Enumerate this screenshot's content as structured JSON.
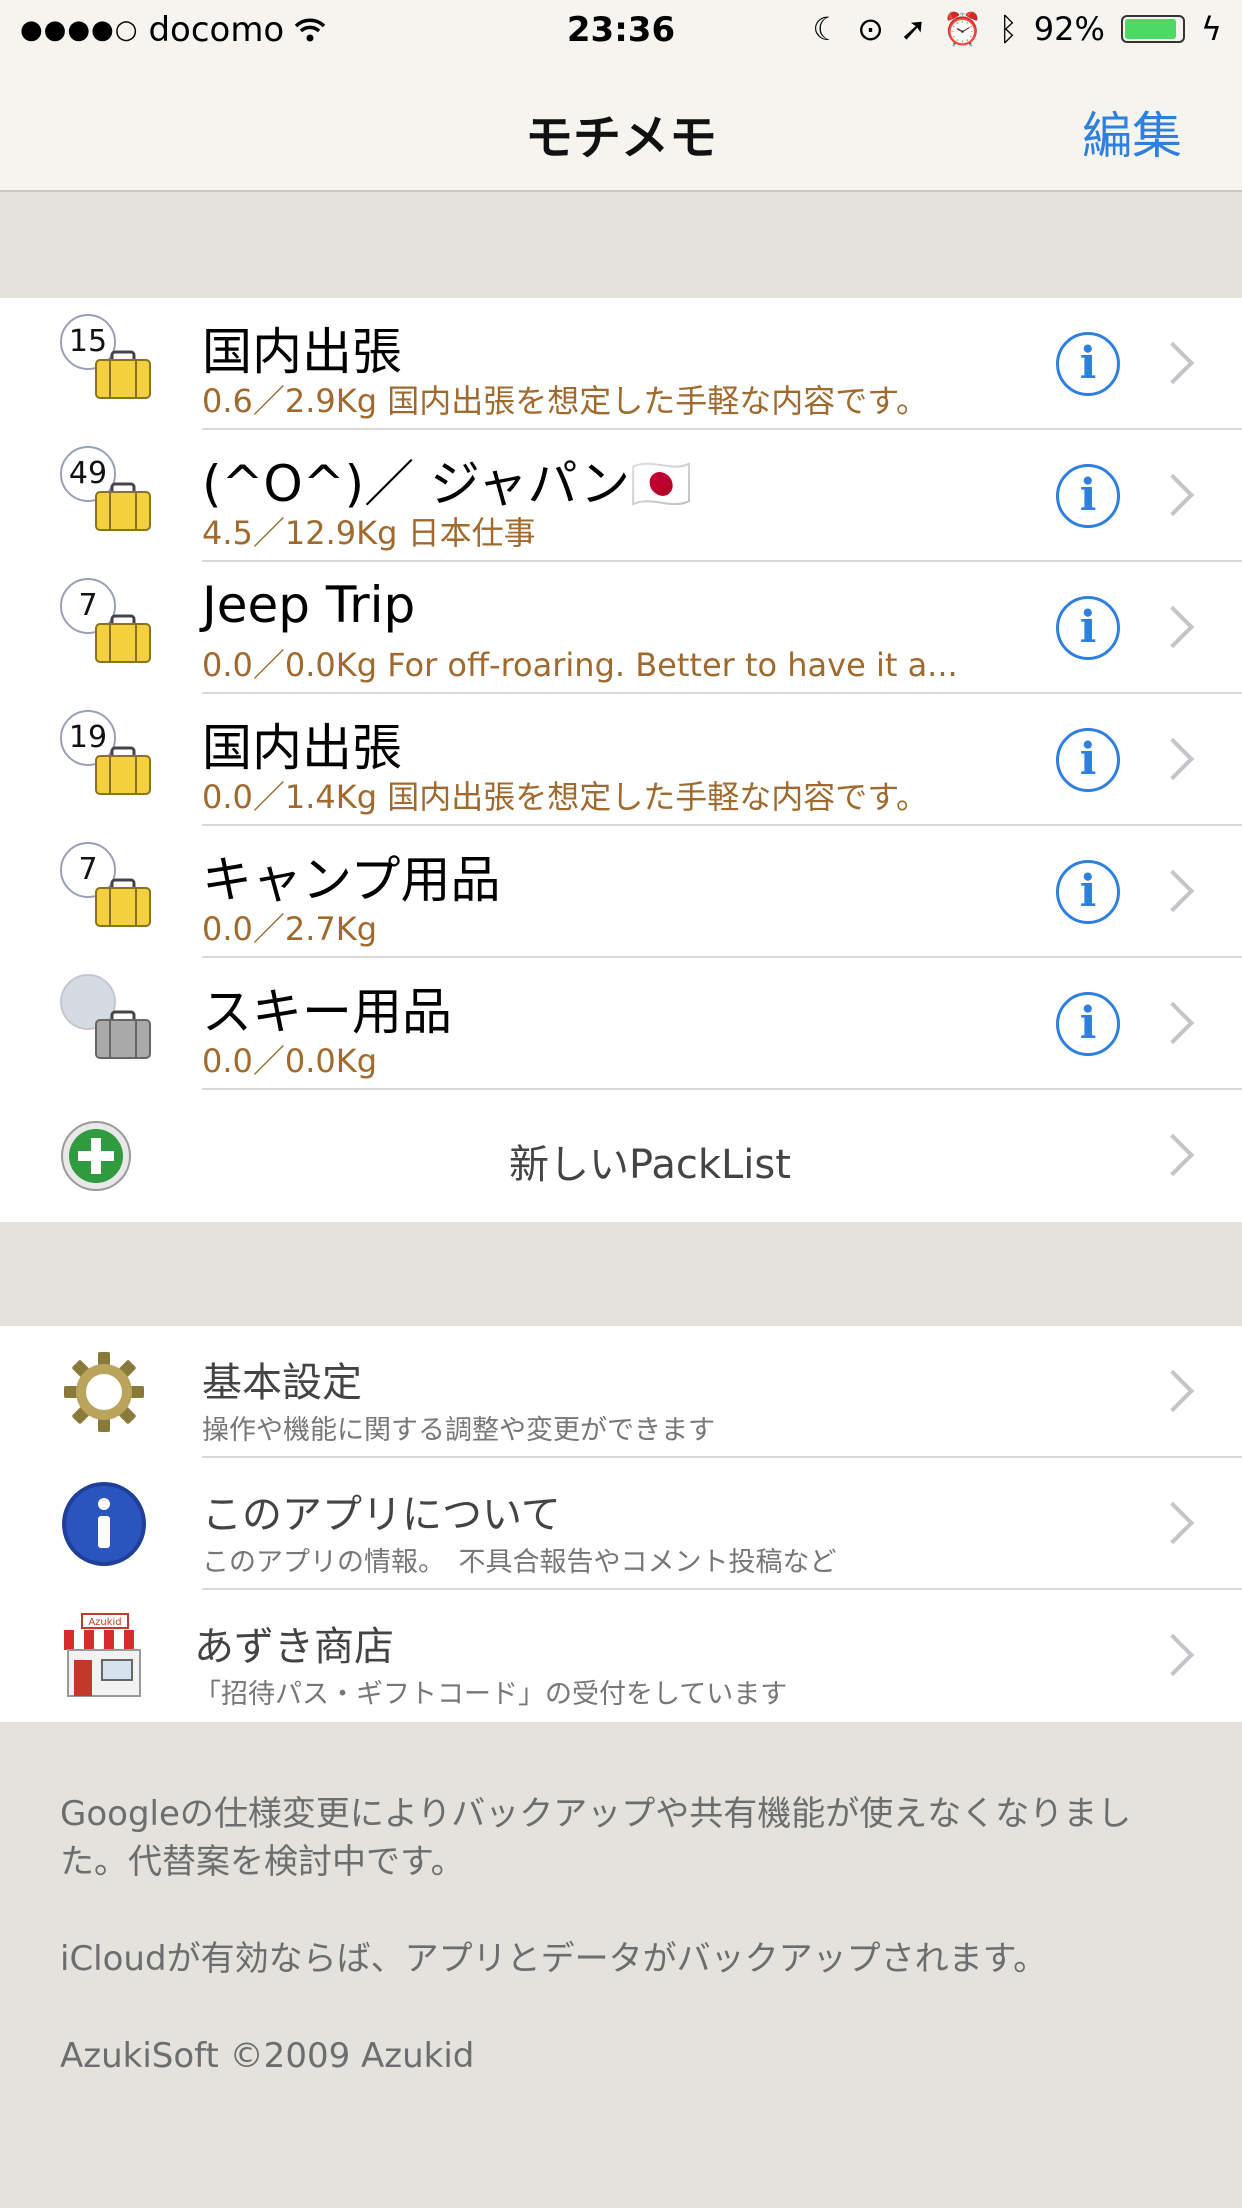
{
  "status_bar": {
    "signal": "●●●●○",
    "carrier": "docomo",
    "time": "23:36",
    "battery": "92%",
    "battery_level": 0.92
  },
  "navbar": {
    "title": "モチメモ",
    "edit_label": "編集"
  },
  "pack_lists": [
    {
      "count": "15",
      "title": "国内出張",
      "subtitle": "0.6／2.9Kg  国内出張を想定した手軽な内容です。",
      "bag_color": "#f4d03f"
    },
    {
      "count": "49",
      "title": "(^O^)／ ジャパン🇯🇵",
      "subtitle": "4.5／12.9Kg  日本仕事",
      "bag_color": "#f4d03f"
    },
    {
      "count": "7",
      "title": "Jeep Trip",
      "subtitle": "0.0／0.0Kg  For off-roaring. Better to have it a...",
      "bag_color": "#f4d03f"
    },
    {
      "count": "19",
      "title": "国内出張",
      "subtitle": "0.0／1.4Kg  国内出張を想定した手軽な内容です。",
      "bag_color": "#f4d03f"
    },
    {
      "count": "7",
      "title": "キャンプ用品",
      "subtitle": "0.0／2.7Kg",
      "bag_color": "#f4d03f"
    },
    {
      "count": "",
      "title": "スキー用品",
      "subtitle": "0.0／0.0Kg",
      "bag_color": "#a9a9a9"
    }
  ],
  "new_packlist_label": "新しいPackList",
  "settings": [
    {
      "icon": "gear-icon",
      "title": "基本設定",
      "subtitle": "操作や機能に関する調整や変更ができます"
    },
    {
      "icon": "info-icon",
      "title": "このアプリについて",
      "subtitle": "このアプリの情報。　不具合報告やコメント投稿など"
    },
    {
      "icon": "shop-icon",
      "title": "あずき商店",
      "subtitle": "「招待パス・ギフトコード」の受付をしています",
      "icon_text": "Azukid"
    }
  ],
  "footer": {
    "note": "Googleの仕様変更によりバックアップや共有機能が使えなくなりました。代替案を検討中です。",
    "icloud": "iCloudが有効ならば、アプリとデータがバックアップされます。",
    "copyright": "AzukiSoft ©2009 Azukid"
  },
  "colors": {
    "accent": "#2f7fe0",
    "subtitle": "#a06a2e",
    "background": "#e3e2dc"
  }
}
